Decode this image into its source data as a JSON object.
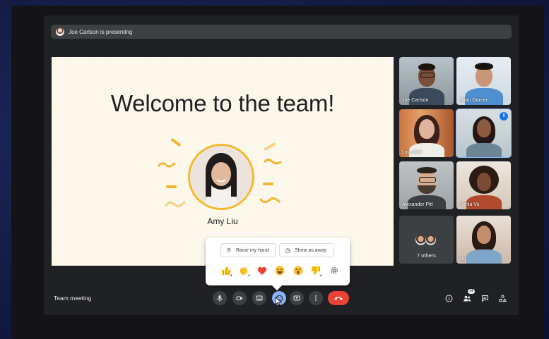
{
  "presenting_bar": {
    "text": "Joe Carlson is presenting"
  },
  "slide": {
    "title": "Welcome to the team!",
    "person_name": "Amy Liu"
  },
  "participants": [
    {
      "name": "Joe Carlson"
    },
    {
      "name": "Lilian Garner"
    },
    {
      "name": "Lina Dürr"
    },
    {
      "name": "",
      "speaking": true
    },
    {
      "name": "Alexander Pitt"
    },
    {
      "name": "Nahla Vu"
    },
    {
      "name": "7 others"
    },
    {
      "name": "Liu"
    }
  ],
  "reaction_popup": {
    "raise_hand_label": "Raise my hand",
    "show_away_label": "Show as away",
    "emojis": [
      "👍",
      "👏",
      "❤️",
      "😀",
      "😮",
      "👎"
    ]
  },
  "meeting": {
    "name": "Team meeting",
    "participant_count": "14"
  },
  "colors": {
    "end_call": "#ea4335",
    "active_control": "#8ab4f8",
    "accent": "#f3b62f"
  }
}
